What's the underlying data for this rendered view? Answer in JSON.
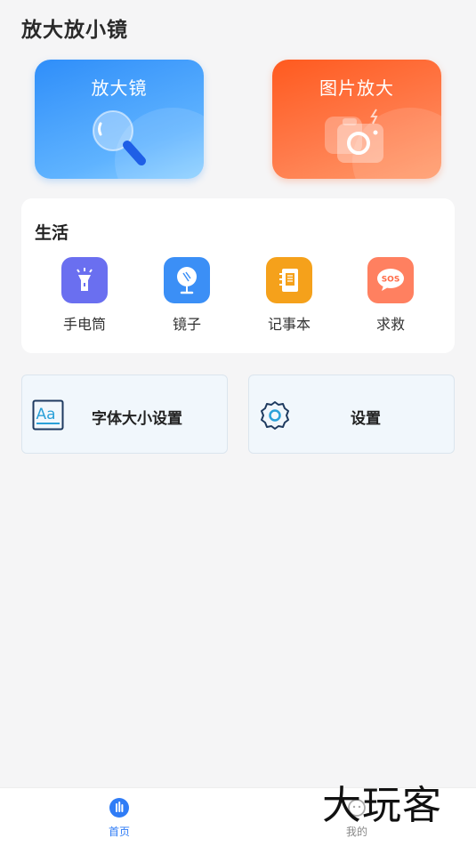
{
  "header": {
    "title": "放大放小镜"
  },
  "hero_cards": [
    {
      "label": "放大镜",
      "icon": "magnifier-icon"
    },
    {
      "label": "图片放大",
      "icon": "camera-icon"
    }
  ],
  "life": {
    "title": "生活",
    "tools": [
      {
        "label": "手电筒",
        "icon": "flashlight-icon",
        "color": "#6a6ff0"
      },
      {
        "label": "镜子",
        "icon": "mirror-icon",
        "color": "#3b8ff6"
      },
      {
        "label": "记事本",
        "icon": "notebook-icon",
        "color": "#f5a11b"
      },
      {
        "label": "求救",
        "icon": "sos-icon",
        "color": "#ff8060",
        "badge": "SOS"
      }
    ]
  },
  "settings": [
    {
      "label": "字体大小设置",
      "icon": "font-size-icon",
      "icon_text": "Aa"
    },
    {
      "label": "设置",
      "icon": "gear-icon"
    }
  ],
  "bottom_nav": [
    {
      "label": "首页",
      "icon": "home-icon",
      "active": true,
      "color": "#2f7cf6"
    },
    {
      "label": "我的",
      "icon": "profile-icon",
      "active": false,
      "color": "#999999"
    }
  ],
  "watermark": "大玩客"
}
